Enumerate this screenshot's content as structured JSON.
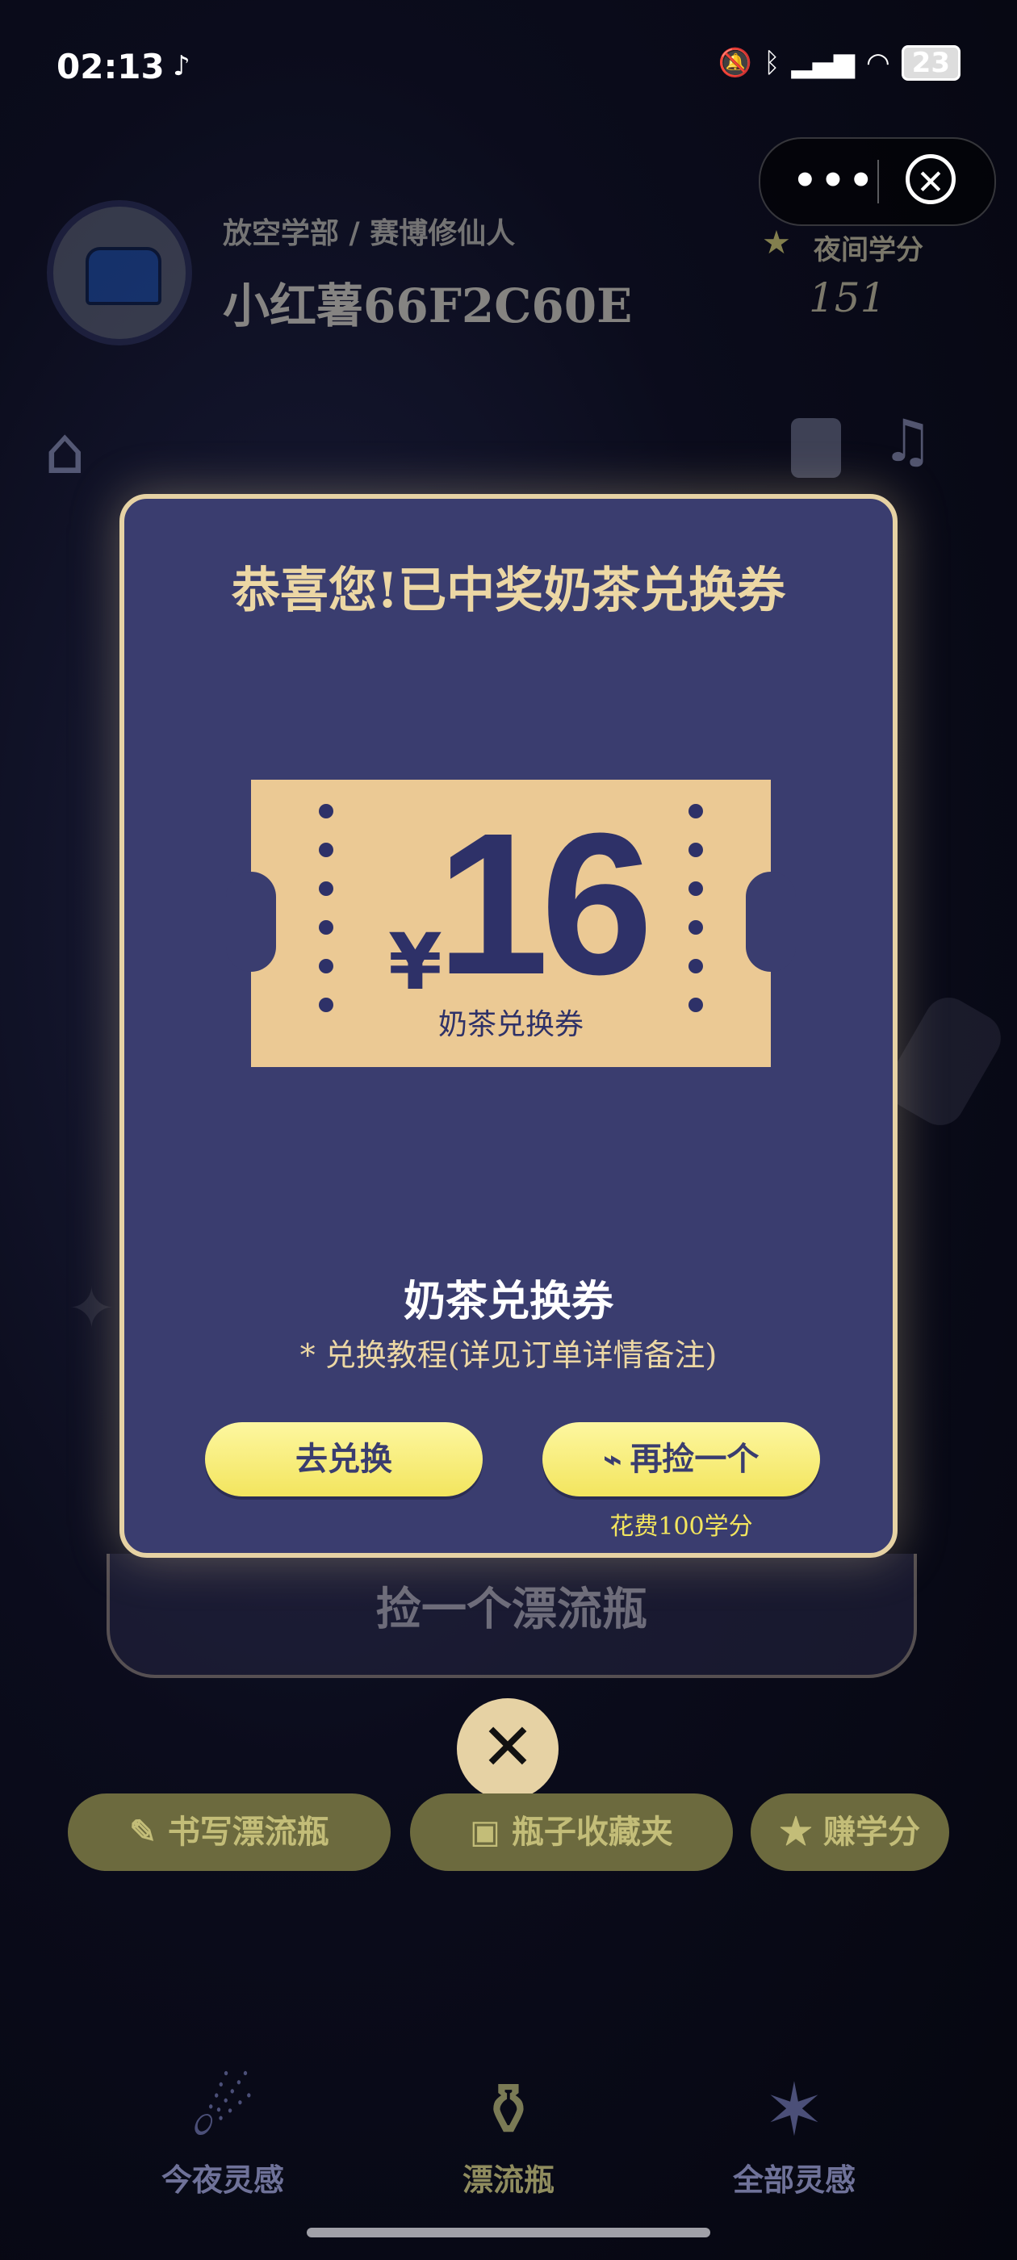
{
  "status_bar": {
    "time": "02:13",
    "battery": "23",
    "icons": [
      "tiktok-icon",
      "bell-off-icon",
      "bluetooth-icon",
      "4g-signal-icon",
      "wifi-icon",
      "battery-icon"
    ]
  },
  "capsule": {
    "more_label": "•••",
    "close_label": "✕"
  },
  "header": {
    "breadcrumb": "放空学部  /  赛博修仙人",
    "username": "小红薯66F2C60E",
    "points_label": "夜间学分",
    "points_value": "151"
  },
  "modal": {
    "title": "恭喜您!已中奖奶茶兑换券",
    "ticket": {
      "currency": "¥",
      "amount": "16",
      "caption": "奶茶兑换券"
    },
    "prize_name": "奶茶兑换券",
    "prize_note": "* 兑换教程(详见订单详情备注)",
    "redeem_label": "去兑换",
    "again_label": "再捡一个",
    "cost_note": "花费100学分"
  },
  "behind": {
    "pick_bottle_label": "捡一个漂流瓶",
    "close_label": "✕",
    "write_label": "书写漂流瓶",
    "collection_label": "瓶子收藏夹",
    "earn_label": "赚学分"
  },
  "nav": {
    "tabs": [
      {
        "label": "今夜灵感",
        "icon": "shooting-star-icon",
        "active": false
      },
      {
        "label": "漂流瓶",
        "icon": "bottle-icon",
        "active": true
      },
      {
        "label": "全部灵感",
        "icon": "stars-icon",
        "active": false
      }
    ]
  },
  "colors": {
    "modal_bg": "#3a3d6f",
    "modal_border": "#e6d2a4",
    "ticket_bg": "#ebc994",
    "button_yellow": "#f3e55e",
    "title_gold": "#ecd7a4"
  }
}
